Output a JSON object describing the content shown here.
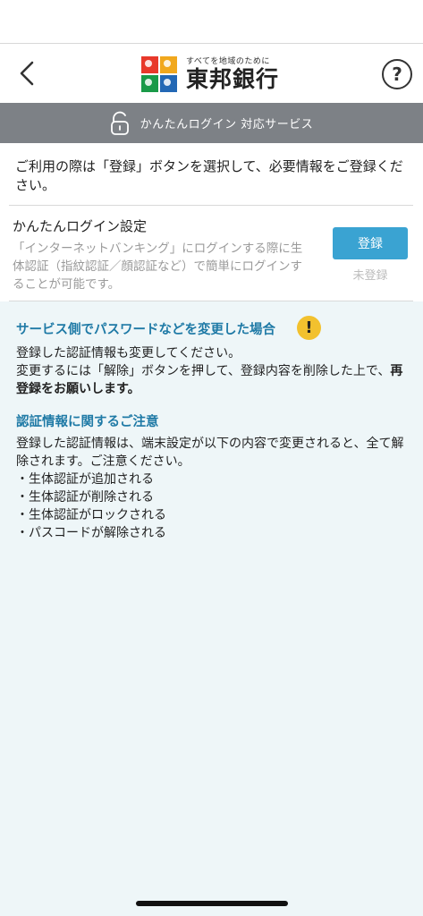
{
  "header": {
    "logo": {
      "tagline": "すべてを地域のために",
      "name": "東邦銀行",
      "mark_colors": [
        "#e8382a",
        "#f1a81d",
        "#1a9a48",
        "#2368b5"
      ]
    },
    "help_label": "?"
  },
  "banner": {
    "text": "かんたんログイン 対応サービス"
  },
  "intro": {
    "text": "ご利用の際は「登録」ボタンを選択して、必要情報をご登録ください。"
  },
  "setting": {
    "title": "かんたんログイン設定",
    "description": "「インターネットバンキング」にログインする際に生体認証（指紋認証／顔認証など）で簡単にログインすることが可能です。",
    "button_label": "登録",
    "status": "未登録"
  },
  "notice": {
    "password_change": {
      "heading": "サービス側でパスワードなどを変更した場合",
      "line1": "登録した認証情報も変更してください。",
      "line2": "変更するには「解除」ボタンを押して、登録内容を削除した上で、",
      "line2_emphasis": "再登録をお願いします。"
    },
    "caution": {
      "heading": "認証情報に関するご注意",
      "body": "登録した認証情報は、端末設定が以下の内容で変更されると、全て解除されます。ご注意ください。",
      "items": [
        "・生体認証が追加される",
        "・生体認証が削除される",
        "・生体認証がロックされる",
        "・パスコードが解除される"
      ]
    }
  },
  "colors": {
    "accent": "#3aa3d2",
    "heading": "#1f7aa6",
    "banner_bg": "#7d8186",
    "panel_bg": "#eef6f8",
    "warning": "#f2c12e"
  }
}
